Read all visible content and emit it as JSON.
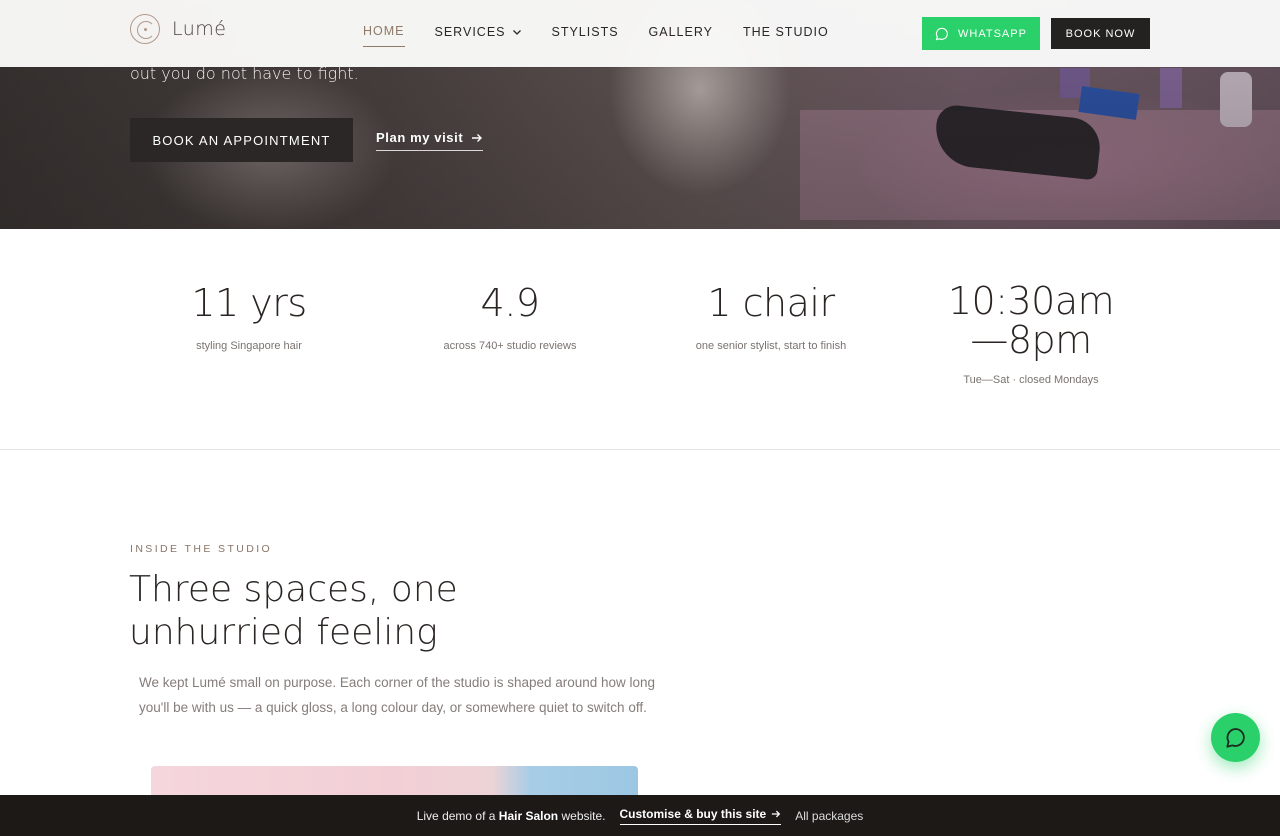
{
  "header": {
    "logo_text": "Lumé",
    "nav": [
      {
        "label": "HOME",
        "active": true
      },
      {
        "label": "SERVICES",
        "dropdown": true
      },
      {
        "label": "STYLISTS"
      },
      {
        "label": "GALLERY"
      },
      {
        "label": "THE STUDIO"
      }
    ],
    "whatsapp_label": "WHATSAPP",
    "book_label": "BOOK NOW"
  },
  "hero": {
    "tagline_tail": "out you do not have to fight.",
    "cta_primary": "BOOK AN APPOINTMENT",
    "cta_secondary": "Plan my visit"
  },
  "stats": [
    {
      "value": "11 yrs",
      "label": "styling Singapore hair"
    },
    {
      "value": "4.9",
      "label": "across 740+ studio reviews"
    },
    {
      "value": "1 chair",
      "label": "one senior stylist, start to finish"
    },
    {
      "value": "10:30am—8pm",
      "label": "Tue—Sat · closed Mondays"
    }
  ],
  "studio": {
    "eyebrow": "INSIDE THE STUDIO",
    "title": "Three spaces, one unhurried feeling",
    "body": "We kept Lumé small on purpose. Each corner of the studio is shaped around how long you'll be with us — a quick gloss, a long colour day, or somewhere quiet to switch off."
  },
  "demo_bar": {
    "prefix": "Live demo of a",
    "site_type": "Hair Salon",
    "suffix": "website.",
    "customise_label": "Customise & buy this site",
    "packages_label": "All packages"
  },
  "colors": {
    "accent": "#8f7968",
    "whatsapp_green": "#2ad16a",
    "dark": "#242121"
  },
  "icons": {
    "whatsapp": "chat-bubble-icon",
    "arrow": "arrow-right-icon",
    "chevron": "chevron-down-icon"
  }
}
